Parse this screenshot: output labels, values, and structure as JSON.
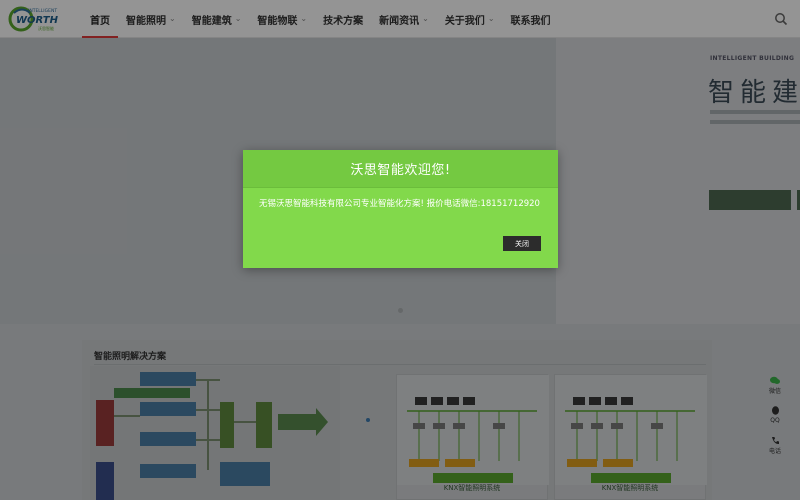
{
  "header": {
    "logo_text": "WORTH",
    "logo_tagline": "INTELLIGENT",
    "nav": [
      {
        "label": "首页",
        "dropdown": false,
        "active": true
      },
      {
        "label": "智能照明",
        "dropdown": true
      },
      {
        "label": "智能建筑",
        "dropdown": true
      },
      {
        "label": "智能物联",
        "dropdown": true
      },
      {
        "label": "技术方案",
        "dropdown": false
      },
      {
        "label": "新闻资讯",
        "dropdown": true
      },
      {
        "label": "关于我们",
        "dropdown": true
      },
      {
        "label": "联系我们",
        "dropdown": false
      }
    ]
  },
  "hero": {
    "label": "INTELLIGENT BUILDING",
    "title": "智能建"
  },
  "section": {
    "title": "智能照明解决方案",
    "card_captions": [
      "KNX智能照明系统",
      "KNX智能照明系统"
    ]
  },
  "side_tools": [
    {
      "label": "微信",
      "icon": "wechat-icon"
    },
    {
      "label": "QQ",
      "icon": "qq-icon"
    },
    {
      "label": "电话",
      "icon": "phone-icon"
    }
  ],
  "modal": {
    "title": "沃思智能欢迎您!",
    "message": "无锡沃思智能科技有限公司专业智能化方案! 报价电话微信:18151712920",
    "close_label": "关闭"
  },
  "colors": {
    "modal_body": "#82d94b",
    "modal_header": "#74c941",
    "nav_active": "#e03a3a"
  }
}
